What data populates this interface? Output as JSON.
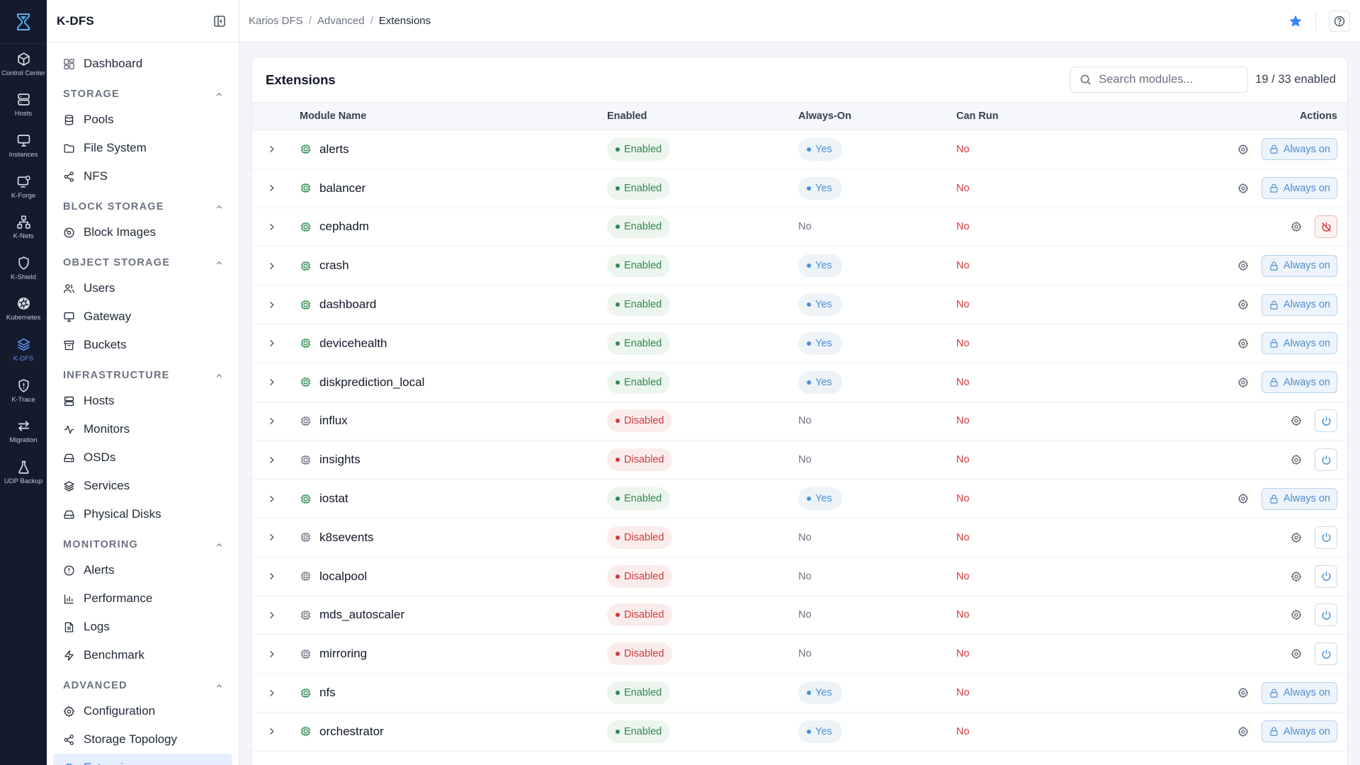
{
  "rail": [
    {
      "label": "Control Center",
      "icon": "cube-icon"
    },
    {
      "label": "Hosts",
      "icon": "server-icon"
    },
    {
      "label": "Instances",
      "icon": "monitor-icon"
    },
    {
      "label": "K-Forge",
      "icon": "forge-icon"
    },
    {
      "label": "K-Nets",
      "icon": "network-icon"
    },
    {
      "label": "K-Shield",
      "icon": "shield-icon"
    },
    {
      "label": "Kubernetes",
      "icon": "kubernetes-icon"
    },
    {
      "label": "K-DFS",
      "icon": "layers-icon",
      "active": true
    },
    {
      "label": "K-Trace",
      "icon": "trace-icon"
    },
    {
      "label": "Migration",
      "icon": "swap-icon"
    },
    {
      "label": "UDP Backup",
      "icon": "flask-icon"
    }
  ],
  "sidebar": {
    "title": "K-DFS",
    "dashboard": "Dashboard",
    "sections": [
      {
        "title": "STORAGE",
        "items": [
          {
            "label": "Pools",
            "icon": "database-icon"
          },
          {
            "label": "File System",
            "icon": "folder-icon"
          },
          {
            "label": "NFS",
            "icon": "share-icon"
          }
        ]
      },
      {
        "title": "BLOCK STORAGE",
        "items": [
          {
            "label": "Block Images",
            "icon": "disc-icon"
          }
        ]
      },
      {
        "title": "OBJECT STORAGE",
        "items": [
          {
            "label": "Users",
            "icon": "users-icon"
          },
          {
            "label": "Gateway",
            "icon": "monitor-icon"
          },
          {
            "label": "Buckets",
            "icon": "archive-icon"
          }
        ]
      },
      {
        "title": "INFRASTRUCTURE",
        "items": [
          {
            "label": "Hosts",
            "icon": "server-icon"
          },
          {
            "label": "Monitors",
            "icon": "activity-icon"
          },
          {
            "label": "OSDs",
            "icon": "harddrive-icon"
          },
          {
            "label": "Services",
            "icon": "layers-icon"
          },
          {
            "label": "Physical Disks",
            "icon": "harddrive-icon"
          }
        ]
      },
      {
        "title": "MONITORING",
        "items": [
          {
            "label": "Alerts",
            "icon": "alert-circle-icon"
          },
          {
            "label": "Performance",
            "icon": "bar-chart-icon"
          },
          {
            "label": "Logs",
            "icon": "file-text-icon"
          },
          {
            "label": "Benchmark",
            "icon": "zap-icon"
          }
        ]
      },
      {
        "title": "ADVANCED",
        "items": [
          {
            "label": "Configuration",
            "icon": "gear-icon"
          },
          {
            "label": "Storage Topology",
            "icon": "share-icon"
          },
          {
            "label": "Extensions",
            "icon": "chip-icon",
            "active": true
          }
        ]
      }
    ]
  },
  "breadcrumb": [
    "Karios DFS",
    "Advanced",
    "Extensions"
  ],
  "page": {
    "title": "Extensions",
    "search_placeholder": "Search modules...",
    "enabled_count": "19 / 33 enabled"
  },
  "table": {
    "headers": [
      "Module Name",
      "Enabled",
      "Always-On",
      "Can Run",
      "Actions"
    ],
    "enabled_label": "Enabled",
    "disabled_label": "Disabled",
    "yes_label": "Yes",
    "no_label": "No",
    "always_on_label": "Always on",
    "rows": [
      {
        "name": "alerts",
        "enabled": true,
        "always_on": true,
        "can_run": "No"
      },
      {
        "name": "balancer",
        "enabled": true,
        "always_on": true,
        "can_run": "No"
      },
      {
        "name": "cephadm",
        "enabled": true,
        "always_on": false,
        "can_run": "No"
      },
      {
        "name": "crash",
        "enabled": true,
        "always_on": true,
        "can_run": "No"
      },
      {
        "name": "dashboard",
        "enabled": true,
        "always_on": true,
        "can_run": "No"
      },
      {
        "name": "devicehealth",
        "enabled": true,
        "always_on": true,
        "can_run": "No"
      },
      {
        "name": "diskprediction_local",
        "enabled": true,
        "always_on": true,
        "can_run": "No"
      },
      {
        "name": "influx",
        "enabled": false,
        "always_on": false,
        "can_run": "No"
      },
      {
        "name": "insights",
        "enabled": false,
        "always_on": false,
        "can_run": "No"
      },
      {
        "name": "iostat",
        "enabled": true,
        "always_on": true,
        "can_run": "No"
      },
      {
        "name": "k8sevents",
        "enabled": false,
        "always_on": false,
        "can_run": "No"
      },
      {
        "name": "localpool",
        "enabled": false,
        "always_on": false,
        "can_run": "No"
      },
      {
        "name": "mds_autoscaler",
        "enabled": false,
        "always_on": false,
        "can_run": "No"
      },
      {
        "name": "mirroring",
        "enabled": false,
        "always_on": false,
        "can_run": "No"
      },
      {
        "name": "nfs",
        "enabled": true,
        "always_on": true,
        "can_run": "No"
      },
      {
        "name": "orchestrator",
        "enabled": true,
        "always_on": true,
        "can_run": "No"
      },
      {
        "name": "",
        "enabled": false,
        "always_on": false,
        "can_run": "",
        "partial": true
      }
    ]
  },
  "colors": {
    "accent": "#2f6ee0",
    "rail_bg": "#141b2d",
    "enabled_green": "#2f8a4a",
    "disabled_red": "#d03a3a",
    "yes_blue": "#4a90d9",
    "star": "#3b82f6"
  }
}
